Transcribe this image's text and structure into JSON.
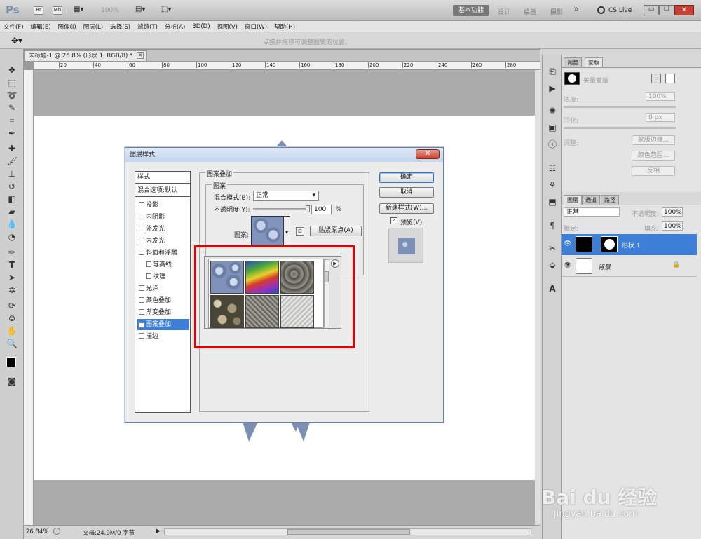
{
  "app": {
    "logo": "Ps",
    "zoom_display": "100%",
    "workspaces": [
      "基本功能",
      "设计",
      "绘画",
      "摄影"
    ],
    "overflow": "»",
    "cs_live": "CS Live"
  },
  "menu": [
    "文件(F)",
    "编辑(E)",
    "图像(I)",
    "图层(L)",
    "选择(S)",
    "滤镜(T)",
    "分析(A)",
    "3D(D)",
    "视图(V)",
    "窗口(W)",
    "帮助(H)"
  ],
  "options_bar": {
    "hint": "点按并拖移可调整图案的位置。"
  },
  "document": {
    "tab_title": "未标题-1 @ 26.8% (形状 1, RGB/8) *",
    "ruler_ticks": [
      "20",
      "40",
      "60",
      "80",
      "100",
      "120",
      "140",
      "160",
      "180",
      "200",
      "220",
      "240",
      "260",
      "280"
    ],
    "status_zoom": "26.84%",
    "status_doc": "文档:24.9M/0 字节"
  },
  "dialog": {
    "title": "图层样式",
    "styles_header": "样式",
    "blend_default": "混合选项:默认",
    "style_items": [
      {
        "label": "投影",
        "checked": false,
        "indent": false
      },
      {
        "label": "内阴影",
        "checked": false,
        "indent": false
      },
      {
        "label": "外发光",
        "checked": false,
        "indent": false
      },
      {
        "label": "内发光",
        "checked": false,
        "indent": false
      },
      {
        "label": "斜面和浮雕",
        "checked": false,
        "indent": false
      },
      {
        "label": "等高线",
        "checked": false,
        "indent": true
      },
      {
        "label": "纹理",
        "checked": false,
        "indent": true
      },
      {
        "label": "光泽",
        "checked": false,
        "indent": false
      },
      {
        "label": "颜色叠加",
        "checked": false,
        "indent": false
      },
      {
        "label": "渐变叠加",
        "checked": false,
        "indent": false
      },
      {
        "label": "图案叠加",
        "checked": true,
        "indent": false,
        "selected": true
      },
      {
        "label": "描边",
        "checked": false,
        "indent": false
      }
    ],
    "section_title": "图案叠加",
    "subsection_title": "图案",
    "blend_mode_label": "混合模式(B):",
    "blend_mode_value": "正常",
    "opacity_label": "不透明度(Y):",
    "opacity_value": "100",
    "opacity_unit": "%",
    "opacity_level": 1.0,
    "pattern_label": "图案:",
    "snap_button": "贴紧原点(A)",
    "ok_button": "确定",
    "cancel_button": "取消",
    "new_style_button": "新建样式(W)...",
    "preview_label": "预览(V)",
    "preview_checked": true
  },
  "panels": {
    "top_tabs": [
      "调整",
      "蒙版"
    ],
    "mask_title": "矢量蒙版",
    "density_label": "浓度:",
    "density_value": "100%",
    "feather_label": "羽化:",
    "feather_value": "0 px",
    "refine_label": "调整:",
    "mask_edge_button": "蒙版边缘...",
    "color_range_button": "颜色范围...",
    "invert_button": "反相",
    "layers_tabs": [
      "图层",
      "通道",
      "路径"
    ],
    "layer_blend": "正常",
    "layer_opacity_label": "不透明度:",
    "layer_opacity_value": "100%",
    "lock_label": "锁定:",
    "fill_label": "填充:",
    "fill_value": "100%",
    "layers": [
      {
        "name": "形状 1",
        "selected": true
      },
      {
        "name": "背景",
        "selected": false,
        "locked": true
      }
    ]
  },
  "colors": {
    "selection_blue": "#3d7fd6",
    "annotation_red": "#e40000",
    "dialog_title_bar": "#c2d4ec"
  },
  "watermark": {
    "logo_text": "Bai du 经验",
    "url": "jingyan.baidu.com"
  }
}
